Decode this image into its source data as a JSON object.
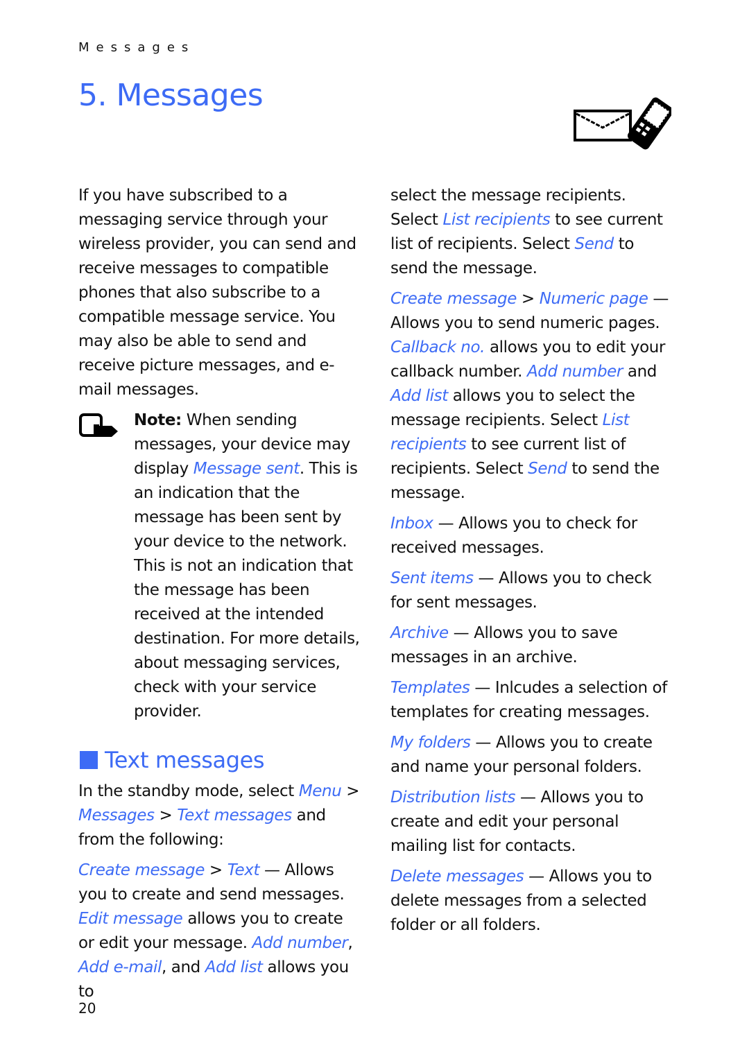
{
  "running_head": "Messages",
  "chapter": {
    "title": "5. Messages",
    "icon": "envelope-phone-icon"
  },
  "intro": "If you have subscribed to a messaging service through your wireless provider, you can send and receive messages to compatible phones that also subscribe to a compatible message service. You may also be able to send and receive picture messages, and e-mail messages.",
  "note": {
    "icon": "note-hand-icon",
    "label": "Note:",
    "text_1": " When sending messages, your device may display ",
    "link": "Message sent",
    "text_2": ". This is an indication that the message has been sent by your device to the network. This is not an indication that the message has been received at the intended destination. For more details, about messaging services, check with your service provider."
  },
  "section": {
    "title": "Text messages",
    "intro": {
      "t1": "In the standby mode, select ",
      "l1": "Menu",
      "t2": " > ",
      "l2": "Messages",
      "t3": " > ",
      "l3": "Text messages",
      "t4": " and from the following:"
    },
    "create_text": {
      "l1": "Create message",
      "t1": " > ",
      "l2": "Text",
      "t2": " — Allows you to create and send messages. ",
      "l3": "Edit message",
      "t3": " allows you to create or edit your message. ",
      "l4": "Add number",
      "t4": ", ",
      "l5": "Add e-mail",
      "t5": ", and ",
      "l6": "Add list",
      "t6": " allows you to select the message recipients. Select ",
      "l7": "List recipients",
      "t7": " to see current list of recipients. Select ",
      "l8": "Send",
      "t8": " to send the message."
    },
    "create_numeric": {
      "l1": "Create message",
      "t1": " > ",
      "l2": "Numeric page",
      "t2": " — Allows you to send numeric pages. ",
      "l3": "Callback no.",
      "t3": " allows you to edit your callback number. ",
      "l4": "Add number",
      "t4": " and ",
      "l5": "Add list",
      "t5": " allows you to select the message recipients. Select ",
      "l6": "List recipients",
      "t6": " to see current list of recipients. Select ",
      "l7": "Send",
      "t7": " to send the message."
    },
    "items": [
      {
        "link": "Inbox",
        "text": " — Allows you to check for received messages."
      },
      {
        "link": "Sent items",
        "text": " — Allows you to check for sent messages."
      },
      {
        "link": "Archive",
        "text": " — Allows you to save messages in an archive."
      },
      {
        "link": "Templates",
        "text": " — Inlcudes a selection of templates for creating messages."
      },
      {
        "link": "My folders",
        "text": " — Allows you to create and name your personal folders."
      },
      {
        "link": "Distribution lists",
        "text": " — Allows you to create and edit your personal mailing list for contacts."
      },
      {
        "link": "Delete messages",
        "text": " — Allows you to delete messages from a selected folder or all folders."
      }
    ]
  },
  "page_number": "20",
  "colors": {
    "accent": "#3d6bf5",
    "text": "#111111"
  }
}
